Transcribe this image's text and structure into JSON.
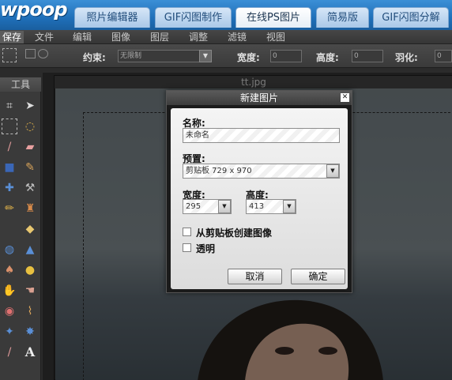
{
  "site": {
    "logo": "wpoop",
    "tabs": [
      "照片编辑器",
      "GIF闪图制作",
      "在线PS图片",
      "简易版",
      "GIF闪图分解"
    ],
    "active_tab": "在线PS图片"
  },
  "menubar": {
    "items": [
      "保存",
      "文件",
      "编辑",
      "图像",
      "图层",
      "调整",
      "滤镜",
      "视图"
    ]
  },
  "options": {
    "constraint_label": "约束:",
    "constraint_value": "无限制",
    "width_label": "宽度:",
    "width_value": "0",
    "height_label": "高度:",
    "height_value": "0",
    "feather_label": "羽化:",
    "feather_value": "0"
  },
  "toolbox": {
    "title": "工具",
    "tools": [
      "crop-icon",
      "move-icon",
      "marquee-icon",
      "lasso-icon",
      "wand-icon",
      "eraser-icon",
      "fill-icon",
      "brush-icon",
      "heal-icon",
      "clone-icon",
      "pencil-icon",
      "stamp-icon",
      "shape-icon",
      "blur-icon",
      "sharpen-icon",
      "dodge-icon",
      "burn-icon",
      "hand-icon",
      "smudge-icon",
      "eye-icon",
      "bandage-icon",
      "color-picker-icon",
      "replace-icon",
      "text-icon"
    ]
  },
  "document": {
    "title": "tt.jpg"
  },
  "dialog": {
    "title": "新建图片",
    "name_label": "名称:",
    "name_value": "未命名",
    "preset_label": "预置:",
    "preset_value": "剪贴板 729 x 970",
    "width_label": "宽度:",
    "width_value": "295",
    "height_label": "高度:",
    "height_value": "413",
    "from_clipboard_label": "从剪贴板创建图像",
    "transparent_label": "透明",
    "cancel_label": "取消",
    "ok_label": "确定",
    "close_glyph": "✕"
  },
  "colors": {
    "tab_active": "#ffffff",
    "tab_inactive": "#a9c8e8",
    "brand_blue": "#1f6fb9"
  }
}
